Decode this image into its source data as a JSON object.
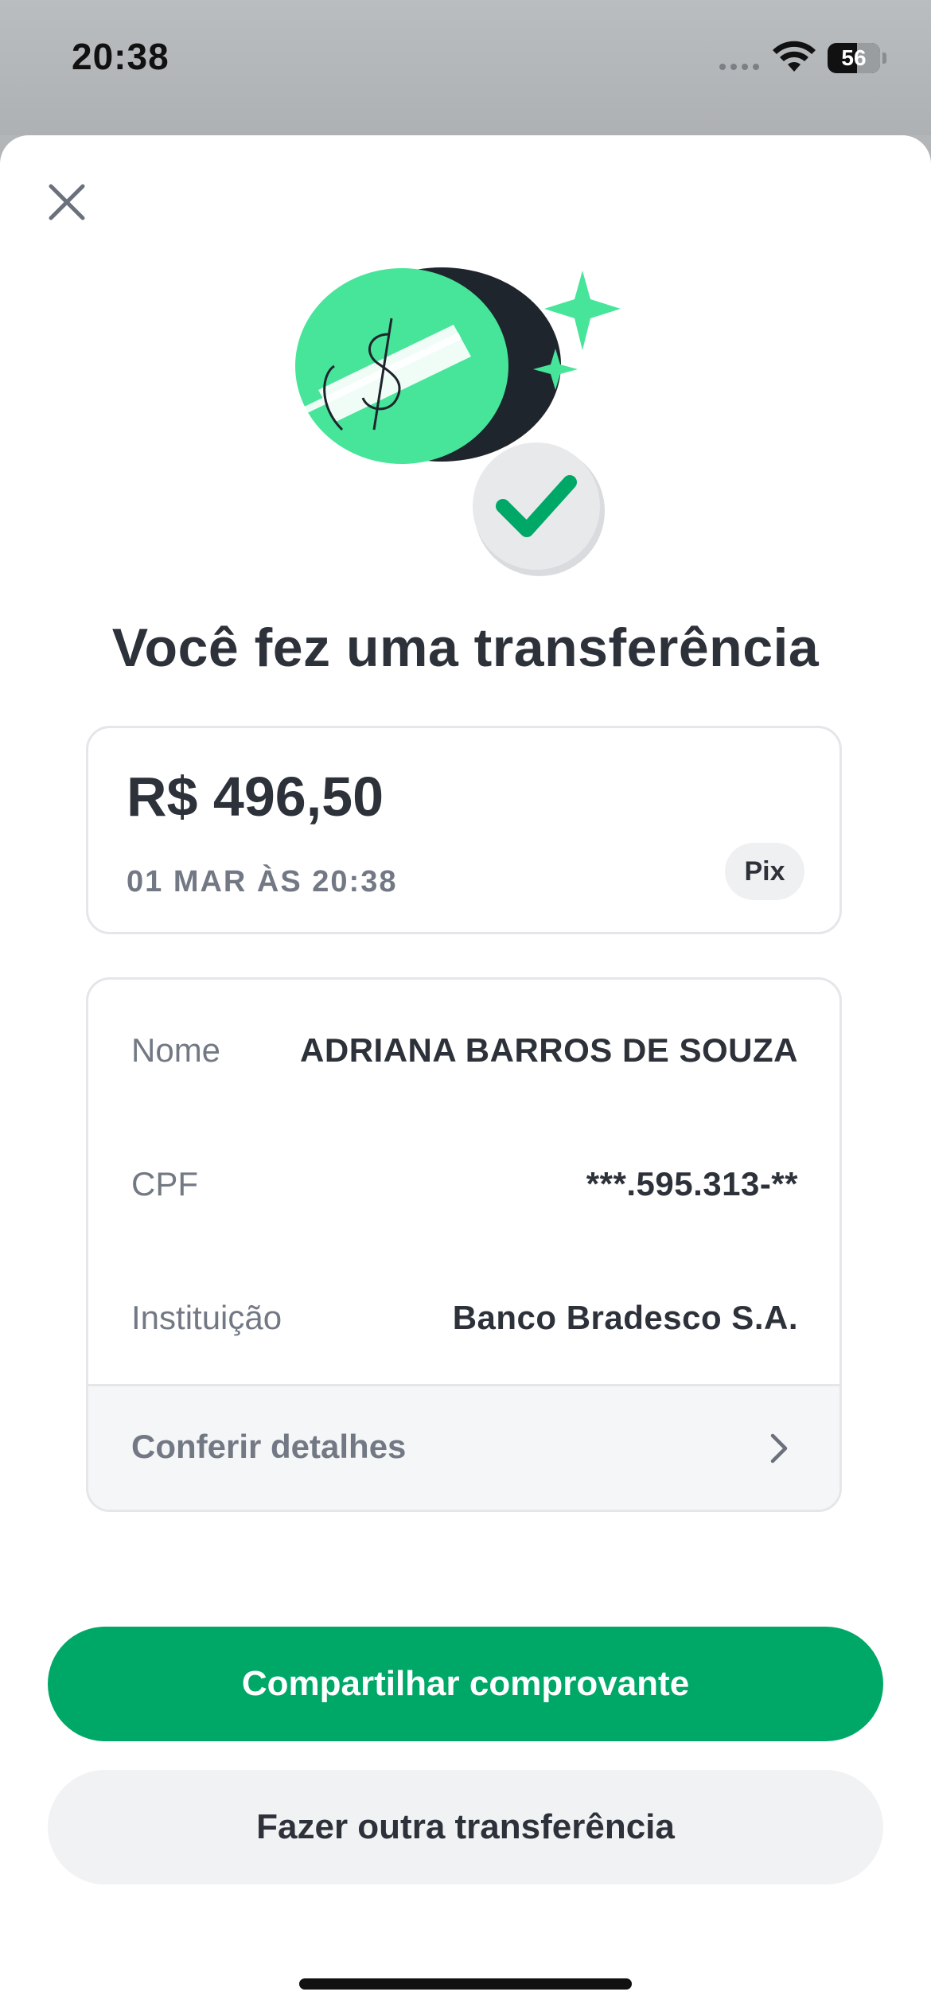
{
  "status_bar": {
    "time": "20:38",
    "battery": "56",
    "battery_level_fraction": 0.56,
    "icons": [
      "signal-dots-icon",
      "wifi-icon",
      "battery-icon"
    ]
  },
  "sheet": {
    "close_icon": "close-icon",
    "illustration": "coin-with-checkmark-illustration",
    "title": "Você fez uma transferência"
  },
  "amount_card": {
    "amount": "R$ 496,50",
    "date": "01 MAR ÀS 20:38",
    "method_badge": "Pix"
  },
  "details": {
    "rows": [
      {
        "label": "Nome",
        "value": "ADRIANA BARROS DE SOUZA"
      },
      {
        "label": "CPF",
        "value": "***.595.313-**"
      },
      {
        "label": "Instituição",
        "value": "Banco Bradesco S.A."
      }
    ],
    "link_label": "Conferir detalhes",
    "link_icon": "chevron-right-icon"
  },
  "actions": {
    "share_label": "Compartilhar comprovante",
    "new_transfer_label": "Fazer outra transferência"
  },
  "colors": {
    "primary_green": "#00a868",
    "illustration_green": "#46e59a",
    "text_dark": "#2d3139",
    "text_muted": "#737984"
  }
}
